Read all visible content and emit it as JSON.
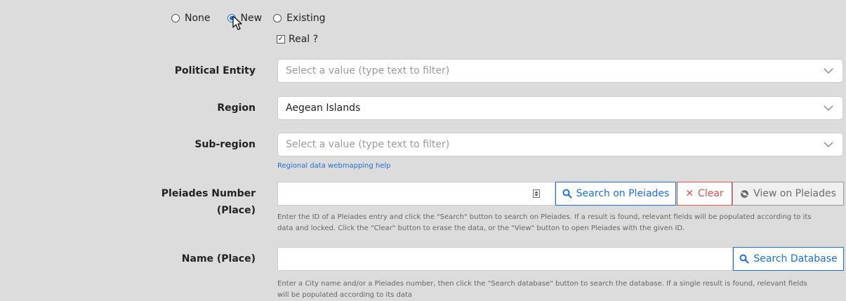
{
  "radios": {
    "options": [
      {
        "label": "None",
        "checked": false
      },
      {
        "label": "New",
        "checked": true
      },
      {
        "label": "Existing",
        "checked": false
      }
    ]
  },
  "real_checkbox": {
    "label": "Real ?",
    "checked": true,
    "mark": "✓"
  },
  "fields": {
    "political_entity": {
      "label": "Political Entity",
      "placeholder": "Select a value (type text to filter)"
    },
    "region": {
      "label": "Region",
      "value": "Aegean Islands"
    },
    "sub_region": {
      "label": "Sub-region",
      "placeholder": "Select a value (type text to filter)",
      "help_link": "Regional data webmapping help"
    },
    "pleiades": {
      "label_line1": "Pleiades Number",
      "label_line2": "(Place)",
      "value": "",
      "search_label": "Search on Pleiades",
      "clear_label": "Clear",
      "view_label": "View on Pleiades",
      "help_line1": "Enter the ID of a Pleiades entry and click the \"Search\" button to search on Pleiades. If a result is found, relevant fields will be populated according to its",
      "help_line2": "data and locked. Click the \"Clear\" button to erase the data, or the \"View\" button to open Pleiades with the given ID."
    },
    "name_place": {
      "label": "Name (Place)",
      "value": "",
      "search_label": "Search Database",
      "help_line1": "Enter a City name and/or a Pleiades number, then click the \"Search database\" button to search the database. If a single result is found, relevant fields",
      "help_line2": "will be populated according to its data"
    }
  },
  "colors": {
    "accent": "#1e6fd9",
    "danger": "#d9534f",
    "background": "#dcdcdc"
  },
  "icons": [
    "search-icon",
    "clear-x-icon",
    "eye-icon",
    "chevron-down-icon",
    "mouse-cursor-icon",
    "spinner-arrows-icon"
  ]
}
